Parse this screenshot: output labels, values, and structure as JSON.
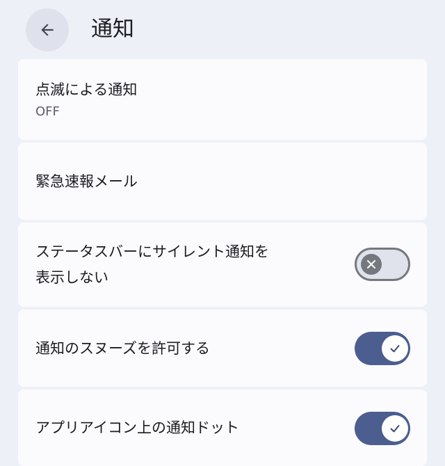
{
  "header": {
    "back_icon": "arrow-left-icon",
    "title": "通知"
  },
  "settings": [
    {
      "title": "点滅による通知",
      "subtitle": "OFF"
    },
    {
      "title": "緊急速報メール"
    },
    {
      "title_line1": "ステータスバーにサイレント通知を",
      "title_line2": "表示しない",
      "toggle": "off",
      "toggle_icon": "close-icon"
    },
    {
      "title": "通知のスヌーズを許可する",
      "toggle": "on",
      "toggle_icon": "check-icon"
    },
    {
      "title": "アプリアイコン上の通知ドット",
      "toggle": "on",
      "toggle_icon": "check-icon"
    }
  ],
  "colors": {
    "background": "#eef0f8",
    "card": "#fbfbfe",
    "toggle_on": "#4b5e8f",
    "toggle_off_track": "#e1e3ec",
    "toggle_off_outline": "#76787f"
  }
}
